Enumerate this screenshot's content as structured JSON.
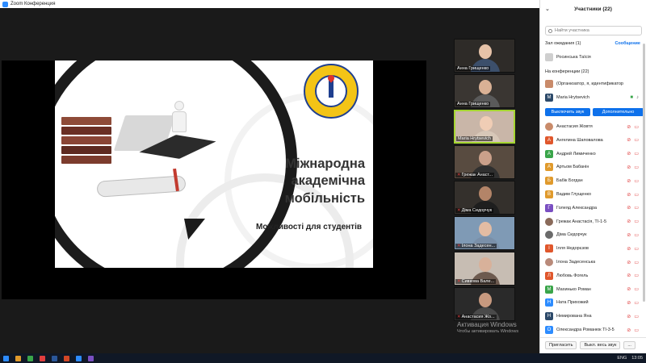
{
  "window": {
    "title": "Zoom Конференция"
  },
  "slide": {
    "title_lines": [
      "Міжнародна",
      "академічна",
      "мобільність"
    ],
    "subtitle": "Можливості для студентів"
  },
  "gallery": [
    {
      "name": "Анна Грищенко",
      "active": false,
      "mic_muted": false
    },
    {
      "name": "Анна Грищенко",
      "active": false,
      "mic_muted": false
    },
    {
      "name": "Maria Hrytsevich",
      "active": true,
      "mic_muted": false
    },
    {
      "name": "Грежак Анаст...",
      "active": false,
      "mic_muted": true
    },
    {
      "name": "Діма Сидорчук",
      "active": false,
      "mic_muted": true
    },
    {
      "name": "Ілона Задесен...",
      "active": false,
      "mic_muted": true
    },
    {
      "name": "Сивкова Вале...",
      "active": false,
      "mic_muted": true
    },
    {
      "name": "Анастасия Жо...",
      "active": false,
      "mic_muted": true
    }
  ],
  "panel": {
    "header": "Участники (22)",
    "search_placeholder": "Найти участника",
    "waiting_label": "Зал ожидания (1)",
    "admit_label": "Сообщение",
    "waiting_person": "Росинська Таїсія",
    "in_meeting_label": "На конференции (22)",
    "host_row": "(Организатор, я, идентификатор участни",
    "maria_row": "Maria Hrytsevich",
    "mute_all_btn": "Выключить звук",
    "more_btn": "Дополнительно",
    "participants": [
      {
        "initial": "",
        "name": "Анастасия Жовтя",
        "color": "#c98b6a",
        "photo": true
      },
      {
        "initial": "А",
        "name": "Ангелина Шаповалова",
        "color": "#e0572c"
      },
      {
        "initial": "А",
        "name": "Андрей Лимиченко",
        "color": "#3aa54a"
      },
      {
        "initial": "А",
        "name": "Артьом Бабанін",
        "color": "#e09a2c"
      },
      {
        "initial": "Б",
        "name": "Бабік Богдан",
        "color": "#e09a2c"
      },
      {
        "initial": "В",
        "name": "Вадим Глущенко",
        "color": "#e09a2c"
      },
      {
        "initial": "Г",
        "name": "Голеяд Александра",
        "color": "#7a4fc2"
      },
      {
        "initial": "",
        "name": "Грежак Анастасія, ТІ-1-5",
        "color": "#8a6a5a",
        "photo": true
      },
      {
        "initial": "",
        "name": "Діма Сидорчук",
        "color": "#6a6a6a",
        "photo": true
      },
      {
        "initial": "І",
        "name": "Ілля Недорєзов",
        "color": "#e0572c"
      },
      {
        "initial": "",
        "name": "Ілона Задесенська",
        "color": "#b98a7a",
        "photo": true
      },
      {
        "initial": "Л",
        "name": "Любовь Фогель",
        "color": "#e0572c"
      },
      {
        "initial": "М",
        "name": "Махинько Роман",
        "color": "#3aa54a"
      },
      {
        "initial": "Н",
        "name": "Ната Прихожий",
        "color": "#2d8cff"
      },
      {
        "initial": "Н",
        "name": "Немирована Яна",
        "color": "#2d4a6a"
      },
      {
        "initial": "О",
        "name": "Олександра Романюк ТІ-3-5",
        "color": "#2d8cff"
      }
    ],
    "invite_btn": "Пригласить",
    "mute_all_footer": "Выкл. весь звук",
    "more_footer": "..."
  },
  "watermark": {
    "line1": "Активация Windows",
    "line2": "Чтобы активировать Windows"
  },
  "taskbar": {
    "lang": "ENG",
    "time": "13:05"
  },
  "colors": {
    "accent": "#0e71eb",
    "active_speaker": "#a5d531",
    "muted": "#e03e3e"
  }
}
